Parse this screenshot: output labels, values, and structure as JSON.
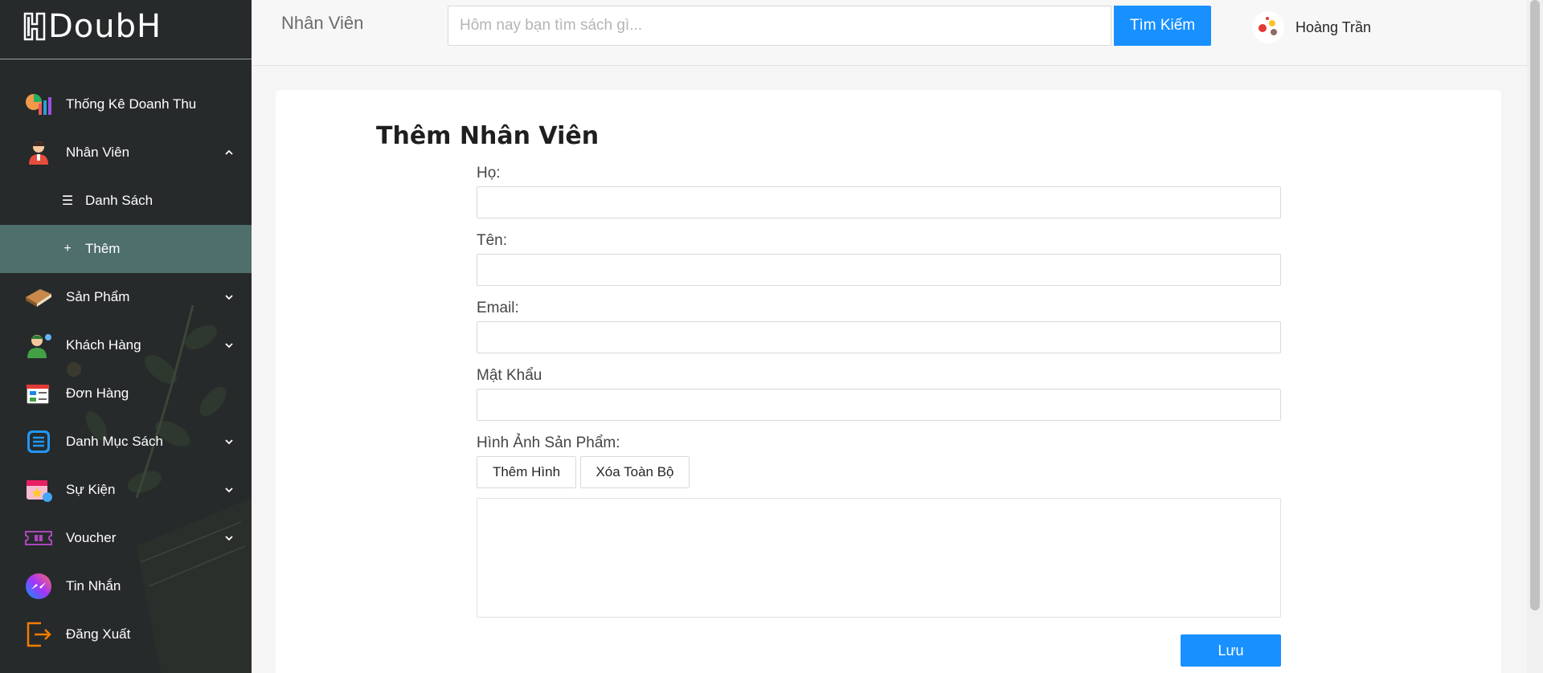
{
  "app": {
    "logo_text": "DoubH"
  },
  "sidebar": {
    "items": [
      {
        "label": "Thống Kê Doanh Thu",
        "icon": "revenue-stats-icon"
      },
      {
        "label": "Nhân Viên",
        "icon": "employee-icon",
        "expanded": true
      },
      {
        "label": "Danh Sách",
        "icon": "list-icon",
        "sub": true
      },
      {
        "label": "Thêm",
        "icon": "plus-icon",
        "sub": true,
        "active": true
      },
      {
        "label": "Sản Phẩm",
        "icon": "book-icon"
      },
      {
        "label": "Khách Hàng",
        "icon": "customer-icon"
      },
      {
        "label": "Đơn Hàng",
        "icon": "order-icon"
      },
      {
        "label": "Danh Mục Sách",
        "icon": "category-icon"
      },
      {
        "label": "Sự Kiện",
        "icon": "event-calendar-icon"
      },
      {
        "label": "Voucher",
        "icon": "voucher-ticket-icon"
      },
      {
        "label": "Tin Nhắn",
        "icon": "messenger-icon"
      },
      {
        "label": "Đăng Xuất",
        "icon": "logout-icon"
      }
    ],
    "active_color": "#4e6f6c",
    "bg_color": "#262a2b"
  },
  "header": {
    "title": "Nhân Viên",
    "search_placeholder": "Hôm nay bạn tìm sách gì...",
    "search_button": "Tìm Kiếm",
    "user_name": "Hoàng Trần"
  },
  "form": {
    "title": "Thêm Nhân Viên",
    "last_name_label": "Họ:",
    "first_name_label": "Tên:",
    "email_label": "Email:",
    "password_label": "Mật Khẩu",
    "image_label": "Hình Ảnh Sản Phẩm:",
    "add_image_button": "Thêm Hình",
    "clear_all_button": "Xóa Toàn Bộ",
    "save_button": "Lưu"
  },
  "colors": {
    "primary": "#1890ff"
  }
}
